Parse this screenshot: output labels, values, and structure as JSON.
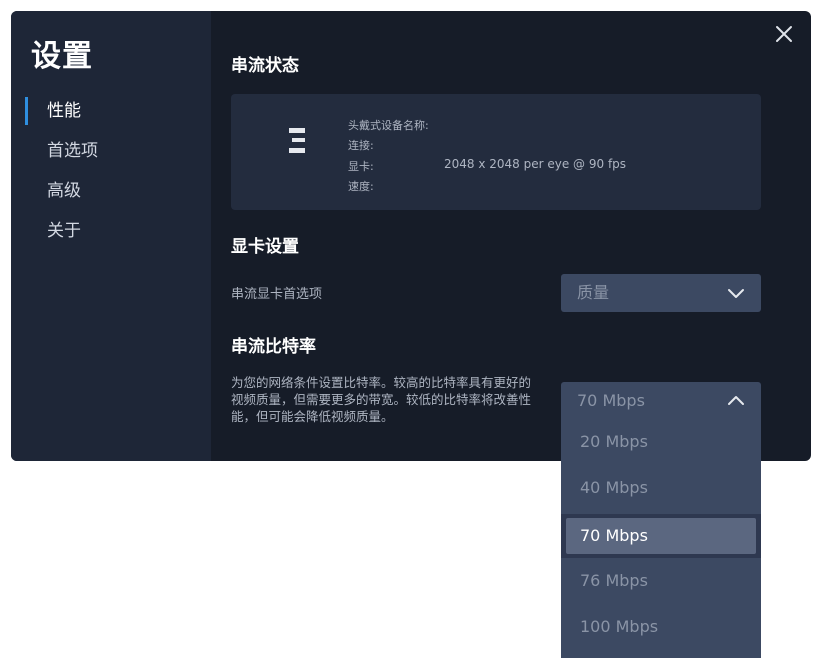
{
  "settings": {
    "title": "设置",
    "nav": [
      {
        "label": "性能",
        "active": true
      },
      {
        "label": "首选项",
        "active": false
      },
      {
        "label": "高级",
        "active": false
      },
      {
        "label": "关于",
        "active": false
      }
    ]
  },
  "window": {
    "close_icon": "close-icon"
  },
  "streaming_status": {
    "title": "串流状态",
    "headset_icon": "headset-icon",
    "headset_name_label": "头戴式设备名称:",
    "connection_label": "连接:",
    "gpu_label": "显卡:",
    "gpu_value": "2048 x 2048 per eye @ 90 fps",
    "speed_label": "速度:"
  },
  "gpu_settings": {
    "title": "显卡设置",
    "preference_label": "串流显卡首选项",
    "preference_value": "质量",
    "chevron_icon": "chevron-down-icon"
  },
  "bitrate": {
    "title": "串流比特率",
    "description": "为您的网络条件设置比特率。较高的比特率具有更好的视频质量，但需要更多的带宽。较低的比特率将改善性能，但可能会降低视频质量。",
    "selected": "70 Mbps",
    "chevron_icon": "chevron-up-icon",
    "options": [
      "20 Mbps",
      "40 Mbps",
      "70 Mbps",
      "76 Mbps",
      "100 Mbps"
    ],
    "selected_index": 2
  },
  "colors": {
    "window_bg": "#161c28",
    "sidebar_bg": "#1e2637",
    "card_bg": "#232c3e",
    "dropdown_bg": "#3c4962",
    "accent": "#2f8fe0",
    "selected_option_bg": "#5b6780"
  }
}
